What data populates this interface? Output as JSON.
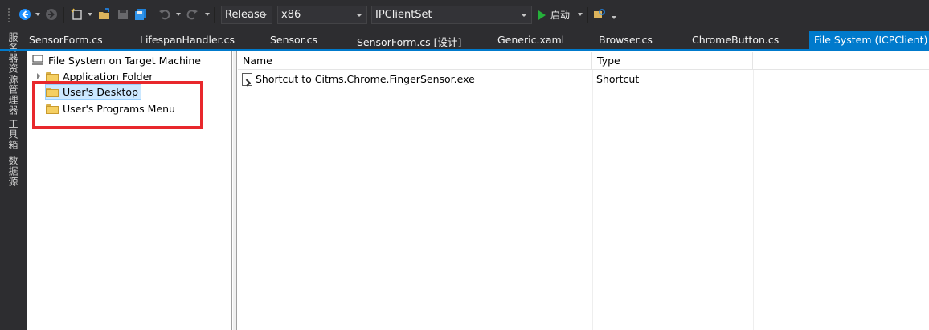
{
  "toolbar": {
    "icons": [
      "back-icon",
      "forward-icon",
      "new-project-icon",
      "open-icon",
      "save-icon",
      "save-all-icon",
      "undo-icon",
      "redo-icon",
      "find-icon"
    ],
    "configuration": "Release",
    "platform": "x86",
    "startup_project": "IPClientSet",
    "start_label": "启动"
  },
  "side_tabs": [
    "服务器资源管理器",
    "工具箱",
    "数据源"
  ],
  "tabs": [
    {
      "label": "SensorForm.cs"
    },
    {
      "label": "LifespanHandler.cs"
    },
    {
      "label": "Sensor.cs"
    },
    {
      "label": "SensorForm.cs [设计]"
    },
    {
      "label": "Generic.xaml"
    },
    {
      "label": "Browser.cs"
    },
    {
      "label": "ChromeButton.cs"
    },
    {
      "label": "File System (ICPClient)",
      "active": true
    }
  ],
  "tree": {
    "root": "File System on Target Machine",
    "items": [
      {
        "label": "Application Folder",
        "expandable": true
      },
      {
        "label": "User's Desktop",
        "selected": true
      },
      {
        "label": "User's Programs Menu"
      }
    ]
  },
  "list": {
    "columns": [
      "Name",
      "Type"
    ],
    "rows": [
      {
        "name": "Shortcut to Citms.Chrome.FingerSensor.exe",
        "type": "Shortcut"
      }
    ]
  },
  "colors": {
    "accent": "#007acc",
    "highlight_box": "#e8282c",
    "selection": "#cce8ff",
    "start_green": "#25b03a"
  }
}
